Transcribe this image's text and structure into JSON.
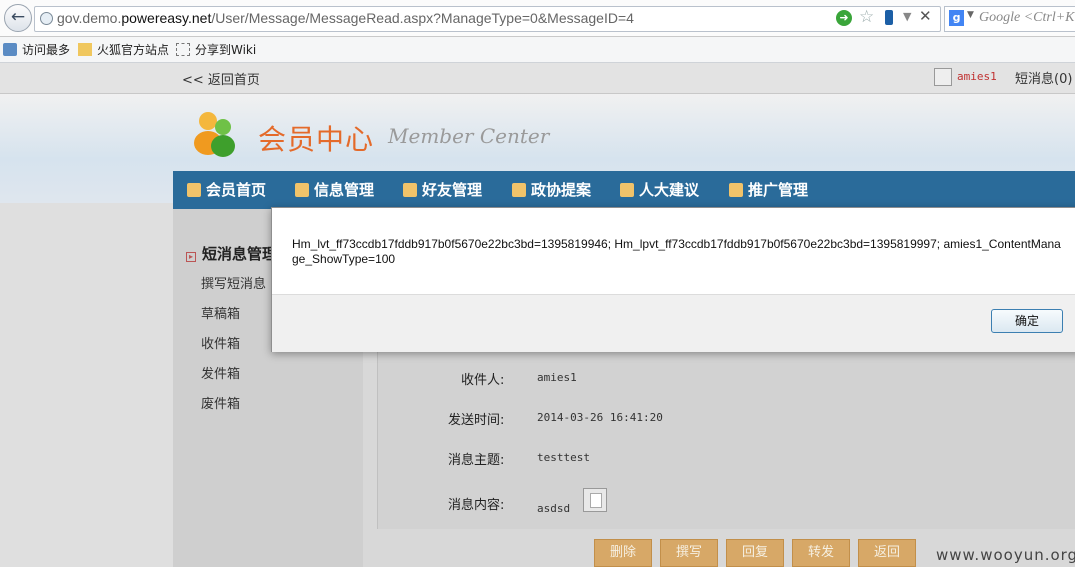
{
  "browser": {
    "url_prefix": "gov.demo.",
    "url_domain": "powereasy.net",
    "url_path": "/User/Message/MessageRead.aspx?ManageType=0&MessageID=4",
    "search_placeholder": "Google <Ctrl+K>",
    "search_engine_letter": "g",
    "bookmarks": [
      "访问最多",
      "火狐官方站点",
      "分享到Wiki"
    ]
  },
  "site": {
    "back_home": "<< 返回首页",
    "username": "amies1",
    "messages_link": "短消息(0)",
    "brand_cn": "会员中心",
    "brand_en": "Member Center",
    "nav": [
      "会员首页",
      "信息管理",
      "好友管理",
      "政协提案",
      "人大建议",
      "推广管理"
    ]
  },
  "sidebar": {
    "title": "短消息管理",
    "items": [
      "撰写短消息",
      "草稿箱",
      "收件箱",
      "发件箱",
      "废件箱"
    ]
  },
  "message": {
    "recipient_label": "收件人:",
    "recipient_value": "amies1",
    "time_label": "发送时间:",
    "time_value": "2014-03-26 16:41:20",
    "subject_label": "消息主题:",
    "subject_value": "testtest",
    "content_label": "消息内容:",
    "content_value": "asdsd"
  },
  "actions": [
    "删除",
    "撰写",
    "回复",
    "转发",
    "返回"
  ],
  "watermark": "www.wooyun.org",
  "dialog": {
    "text": "Hm_lvt_ff73ccdb17fddb917b0f5670e22bc3bd=1395819946; Hm_lpvt_ff73ccdb17fddb917b0f5670e22bc3bd=1395819997; amies1_ContentManage_ShowType=100",
    "ok_label": "确定"
  },
  "colors": {
    "nav_bar": "#2a6b9a",
    "brand_orange": "#e46a2a",
    "action_button": "#d7a867",
    "username_red": "#c03030"
  }
}
